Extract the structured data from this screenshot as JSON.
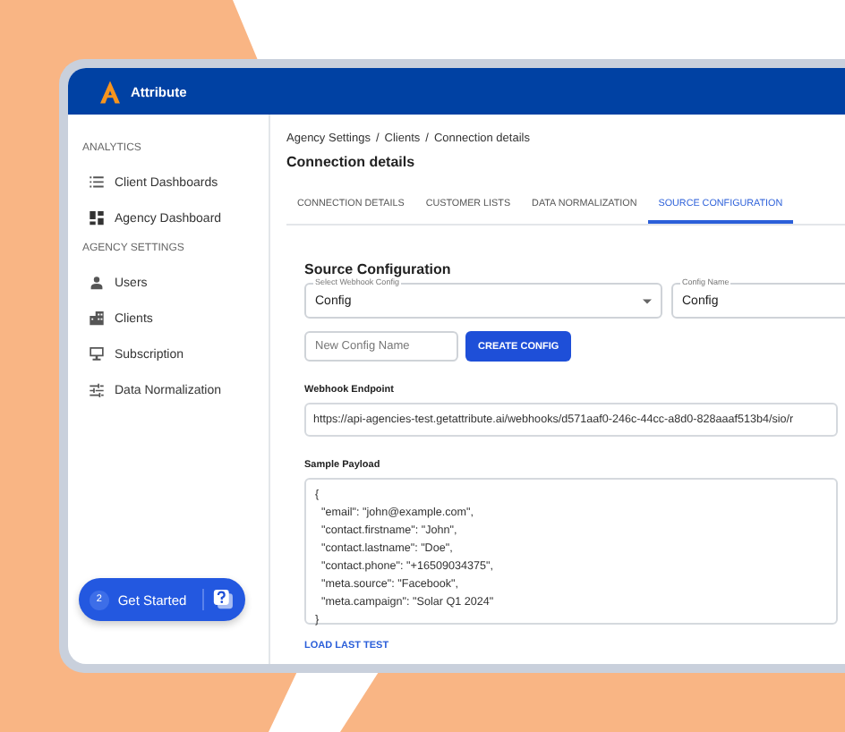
{
  "app": {
    "name": "Attribute"
  },
  "sidebar": {
    "sections": [
      {
        "title": "ANALYTICS",
        "items": [
          {
            "label": "Client Dashboards",
            "selected": false
          },
          {
            "label": "Agency Dashboard",
            "selected": false
          }
        ]
      },
      {
        "title": "AGENCY SETTINGS",
        "items": [
          {
            "label": "Users",
            "selected": false
          },
          {
            "label": "Clients",
            "selected": false
          },
          {
            "label": "Subscription",
            "selected": false
          },
          {
            "label": "Data Normalization",
            "selected": false
          }
        ]
      }
    ]
  },
  "get_started": {
    "badge": "2",
    "label": "Get Started"
  },
  "breadcrumb": [
    "Agency Settings",
    "Clients",
    "Connection details"
  ],
  "breadcrumb_separator": "/",
  "page_title": "Connection details",
  "tabs": [
    {
      "label": "CONNECTION DETAILS",
      "selected": false
    },
    {
      "label": "CUSTOMER LISTS",
      "selected": false
    },
    {
      "label": "DATA NORMALIZATION",
      "selected": false
    },
    {
      "label": "SOURCE CONFIGURATION",
      "selected": true
    }
  ],
  "section_title": "Source Configuration",
  "selects": [
    {
      "label": "Select Webhook Config",
      "value": "Config",
      "kind": "dropdown"
    },
    {
      "label": "Config Name",
      "value": "Config",
      "kind": "text"
    }
  ],
  "new_config": {
    "placeholder": "New Config Name",
    "button": "CREATE CONFIG"
  },
  "webhook": {
    "label": "Webhook Endpoint",
    "value": "https://api-agencies-test.getattribute.ai/webhooks/d571aaf0-246c-44cc-a8d0-828aaaf513b4/sio/r"
  },
  "payload": {
    "label": "Sample Payload",
    "lines": [
      "{",
      "  \"email\": \"john@example.com\",",
      "  \"contact.firstname\": \"John\",",
      "  \"contact.lastname\": \"Doe\",",
      "  \"contact.phone\": \"+16509034375\",",
      "  \"meta.source\": \"Facebook\",",
      "  \"meta.campaign\": \"Solar Q1 2024\"",
      "}"
    ]
  },
  "load_button": "LOAD LAST TEST"
}
